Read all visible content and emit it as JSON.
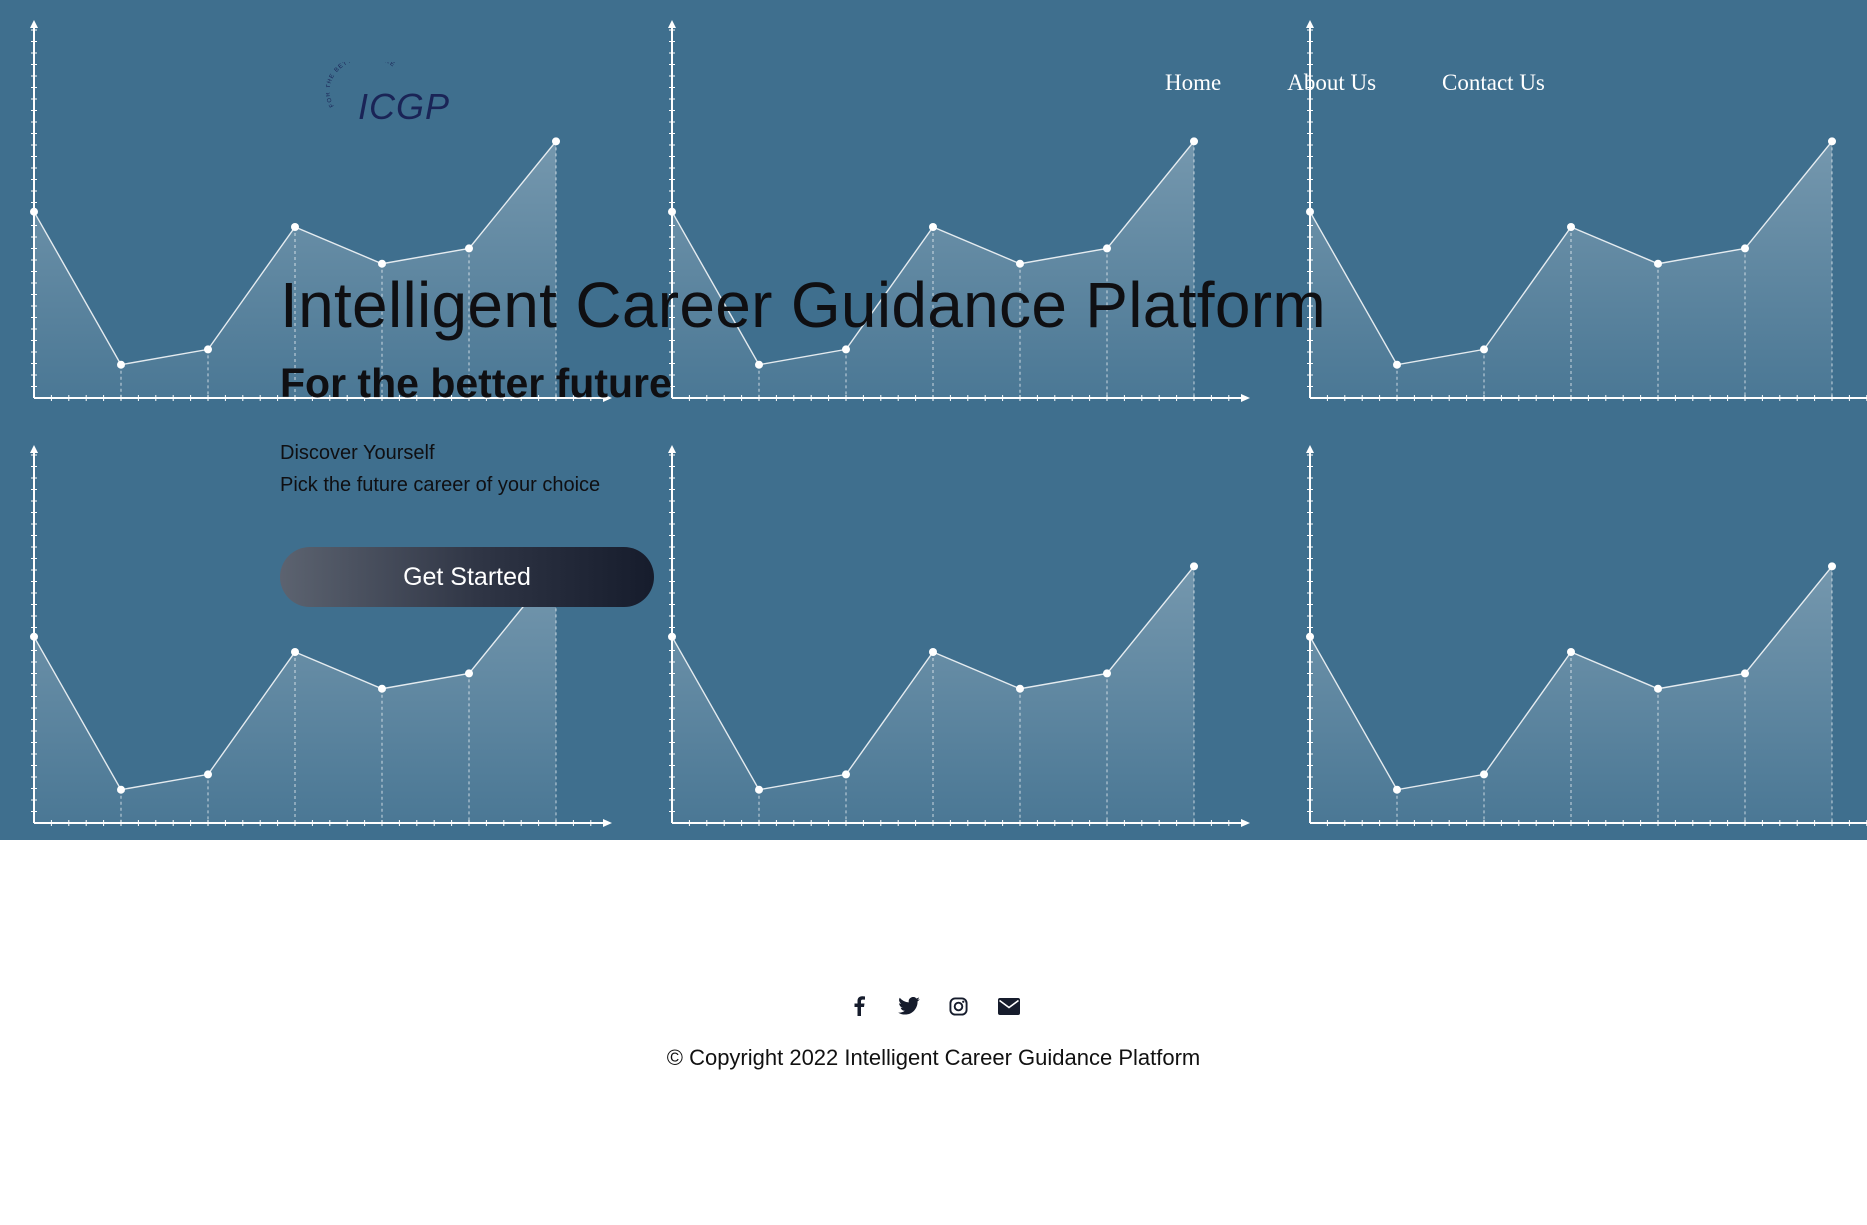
{
  "logo": {
    "text": "ICGP",
    "tagline": "FOR THE BETTER FUTURE"
  },
  "nav": {
    "items": [
      {
        "label": "Home"
      },
      {
        "label": "About Us"
      },
      {
        "label": "Contact Us"
      }
    ]
  },
  "hero": {
    "title": "Intelligent Career Guidance Platform",
    "subtitle": "For the better future",
    "line1": "Discover Yourself",
    "line2": "Pick the future career of your choice",
    "cta_label": "Get Started"
  },
  "background": {
    "graphic": "line-chart-pattern",
    "color": "#3f6f8e",
    "point_values": [
      0.55,
      0.05,
      0.1,
      0.5,
      0.38,
      0.43,
      0.78
    ]
  },
  "footer": {
    "social_icons": [
      "facebook-icon",
      "twitter-icon",
      "instagram-icon",
      "email-icon"
    ],
    "copyright": "© Copyright 2022 Intelligent Career Guidance Platform"
  },
  "colors": {
    "hero_bg": "#3f6f8e",
    "logo": "#1a2456",
    "button_dark": "#161c2c"
  }
}
